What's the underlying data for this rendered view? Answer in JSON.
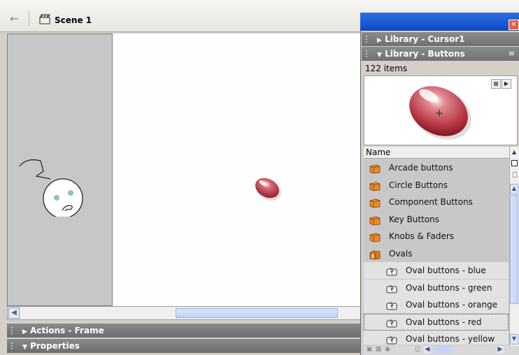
{
  "editbar": {
    "scene_label": "Scene 1"
  },
  "panels": {
    "actions_frame": "Actions - Frame",
    "properties": "Properties"
  },
  "library": {
    "close_glyph": "✕",
    "cursor_header": "Library - Cursor1",
    "buttons_header": "Library - Buttons",
    "item_count": "122 items",
    "column_name": "Name",
    "items": [
      {
        "label": "Arcade buttons",
        "type": "folder"
      },
      {
        "label": "Circle Buttons",
        "type": "folder"
      },
      {
        "label": "Component Buttons",
        "type": "folder"
      },
      {
        "label": "Key Buttons",
        "type": "folder"
      },
      {
        "label": "Knobs & Faders",
        "type": "folder"
      },
      {
        "label": "Ovals",
        "type": "folder-open"
      },
      {
        "label": "Oval buttons - blue",
        "type": "button-symbol"
      },
      {
        "label": "Oval buttons - green",
        "type": "button-symbol"
      },
      {
        "label": "Oval buttons - orange",
        "type": "button-symbol"
      },
      {
        "label": "Oval buttons - red",
        "type": "button-symbol",
        "selected": true
      },
      {
        "label": "Oval buttons - yellow",
        "type": "button-symbol"
      }
    ]
  },
  "colors": {
    "titlebar_blue": "#0a49c8",
    "oval_red": "#c0404a",
    "folder_orange": "#e07a1e"
  }
}
